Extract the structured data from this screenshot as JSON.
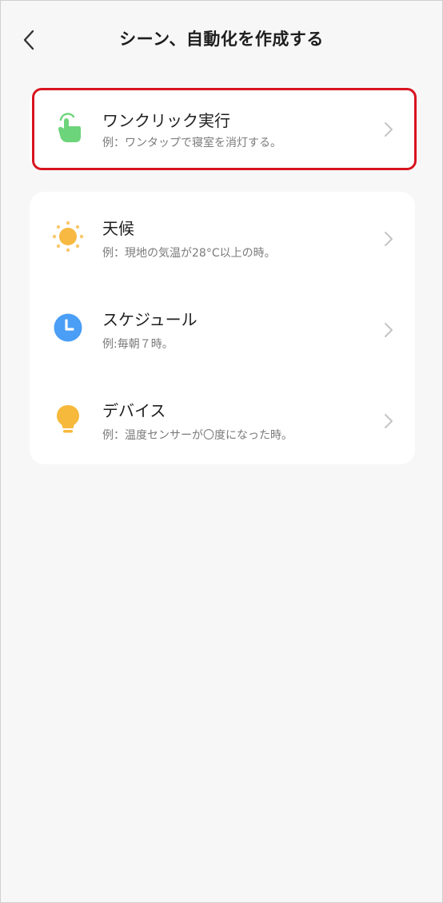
{
  "header": {
    "title": "シーン、自動化を作成する"
  },
  "one_click": {
    "label": "ワンクリック実行",
    "desc": "例：ワンタップで寝室を消灯する。",
    "icon": "tap-hand-icon"
  },
  "conditions": [
    {
      "label": "天候",
      "desc": "例：現地の気温が28°C以上の時。",
      "icon": "sun-icon"
    },
    {
      "label": "スケジュール",
      "desc": "例:毎朝７時。",
      "icon": "clock-icon"
    },
    {
      "label": "デバイス",
      "desc": "例：温度センサーが〇度になった時。",
      "icon": "lightbulb-icon"
    }
  ],
  "colors": {
    "background": "#f7f7f7",
    "card": "#ffffff",
    "highlight": "#d8141f",
    "tap_green": "#6cd47a",
    "sun_orange": "#f7b941",
    "clock_blue": "#4a9ef5",
    "bulb_orange": "#f6b93c"
  }
}
